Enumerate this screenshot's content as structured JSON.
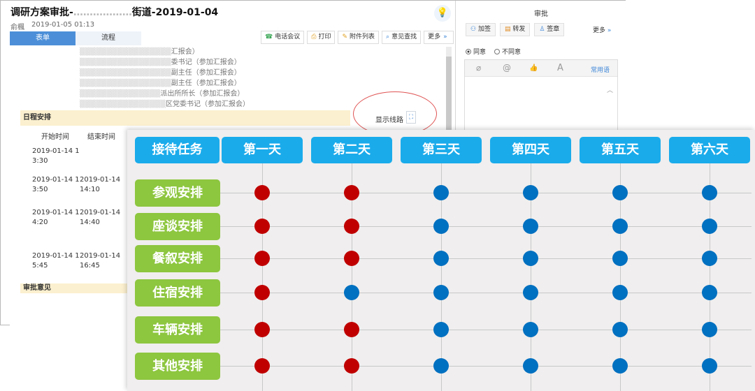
{
  "window": {
    "title": "调研方案审批-",
    "title_suffix": "街道-2019-01-04",
    "drafter": "俞楓",
    "date": "2019-01-05 01:13"
  },
  "tabs": [
    "表单",
    "流程"
  ],
  "toolbar": [
    {
      "label": "电话会议",
      "icon": "phone-icon"
    },
    {
      "label": "打印",
      "icon": "print-icon"
    },
    {
      "label": "附件列表",
      "icon": "attachment-icon"
    },
    {
      "label": "意见查找",
      "icon": "search-icon"
    },
    {
      "label": "更多",
      "icon": "chevron-down-icon"
    }
  ],
  "attendee_lines": [
    "汇报会）",
    "委书记（参加汇报会）",
    "副主任（参加汇报会）",
    "副主任（参加汇报会）",
    "派出所所长（参加汇报会）",
    "区党委书记（参加汇报会）"
  ],
  "schedule": {
    "section_title": "日程安排",
    "show_route_label": "显示线路",
    "columns": [
      "开始时间",
      "结束时间"
    ],
    "rows": [
      {
        "start": [
          "2019-01-14 1",
          "3:30"
        ],
        "end": [
          "",
          ""
        ]
      },
      {
        "start": [
          "2019-01-14 1",
          "3:50"
        ],
        "end": [
          "2019-01-14",
          "14:10"
        ]
      },
      {
        "start": [
          "2019-01-14 1",
          "4:20"
        ],
        "end": [
          "2019-01-14",
          "14:40"
        ]
      },
      {
        "start": [
          "2019-01-14 1",
          "5:45"
        ],
        "end": [
          "2019-01-14",
          "16:45"
        ]
      }
    ],
    "next_section": "审批意见"
  },
  "approval": {
    "title": "审批",
    "actions": [
      {
        "label": "加签",
        "icon": "add-signer-icon"
      },
      {
        "label": "转发",
        "icon": "forward-icon"
      },
      {
        "label": "签章",
        "icon": "seal-icon"
      }
    ],
    "more": "更多",
    "options": [
      {
        "label": "同意",
        "selected": true
      },
      {
        "label": "不同意",
        "selected": false
      }
    ],
    "editor_tools": [
      "attachment-icon",
      "mention-icon",
      "like-icon",
      "font-icon"
    ],
    "editor_tool_glyphs": [
      "⌀",
      "@",
      "👍",
      "A"
    ],
    "common_phrases": "常用语"
  },
  "grid": {
    "corner_label": "接待任务",
    "days": [
      "第一天",
      "第二天",
      "第三天",
      "第四天",
      "第五天",
      "第六天"
    ],
    "tasks": [
      "参观安排",
      "座谈安排",
      "餐叙安排",
      "住宿安排",
      "车辆安排",
      "其他安排"
    ],
    "status_colors": {
      "red": "#c00000",
      "blue": "#0070c0"
    },
    "header_color": "#1aabeb",
    "task_color": "#8dc63f",
    "status": [
      [
        "red",
        "red",
        "blue",
        "blue",
        "blue",
        "blue"
      ],
      [
        "red",
        "red",
        "blue",
        "blue",
        "blue",
        "blue"
      ],
      [
        "red",
        "red",
        "blue",
        "blue",
        "blue",
        "blue"
      ],
      [
        "red",
        "blue",
        "blue",
        "blue",
        "blue",
        "blue"
      ],
      [
        "red",
        "red",
        "blue",
        "blue",
        "blue",
        "blue"
      ],
      [
        "red",
        "red",
        "blue",
        "blue",
        "blue",
        "blue"
      ]
    ]
  }
}
